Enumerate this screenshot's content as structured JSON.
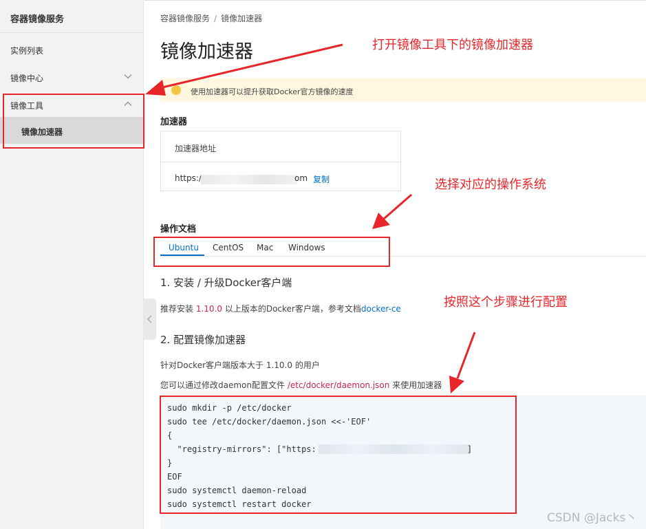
{
  "sidebar": {
    "title": "容器镜像服务",
    "items": [
      {
        "label": "实例列表"
      },
      {
        "label": "镜像中心"
      },
      {
        "label": "镜像工具"
      }
    ],
    "subitem": "镜像加速器"
  },
  "breadcrumb": {
    "root": "容器镜像服务",
    "sep": "/",
    "current": "镜像加速器"
  },
  "page_title": "镜像加速器",
  "notice": "使用加速器可以提升获取Docker官方镜像的速度",
  "accelerator": {
    "section_label": "加速器",
    "header": "加速器地址",
    "url_prefix": "https://",
    "url_suffix": "om",
    "copy": "复制"
  },
  "docs": {
    "section_label": "操作文档",
    "tabs": [
      "Ubuntu",
      "CentOS",
      "Mac",
      "Windows"
    ],
    "active_tab": "Ubuntu"
  },
  "step1": {
    "title": "1. 安装 / 升级Docker客户端",
    "text_a": "推荐安装",
    "version": "1.10.0",
    "text_b": "以上版本的Docker客户端，参考文档",
    "link": "docker-ce"
  },
  "step2": {
    "title": "2. 配置镜像加速器",
    "line1": "针对Docker客户端版本大于 1.10.0 的用户",
    "line2_a": "您可以通过修改daemon配置文件",
    "line2_path": "/etc/docker/daemon.json",
    "line2_b": "来使用加速器"
  },
  "code": [
    "sudo mkdir -p /etc/docker",
    "sudo tee /etc/docker/daemon.json <<-'EOF'",
    "{",
    "  \"registry-mirrors\": [\"https:",
    "}",
    "EOF",
    "sudo systemctl daemon-reload",
    "sudo systemctl restart docker"
  ],
  "code_tail": "]",
  "annotations": {
    "a1": "打开镜像工具下的镜像加速器",
    "a2": "选择对应的操作系统",
    "a3": "按照这个步骤进行配置"
  },
  "watermark": "CSDN @Jacks丶",
  "colors": {
    "annotation": "#e8262a",
    "link": "#0070cc",
    "path": "#c7254e"
  }
}
